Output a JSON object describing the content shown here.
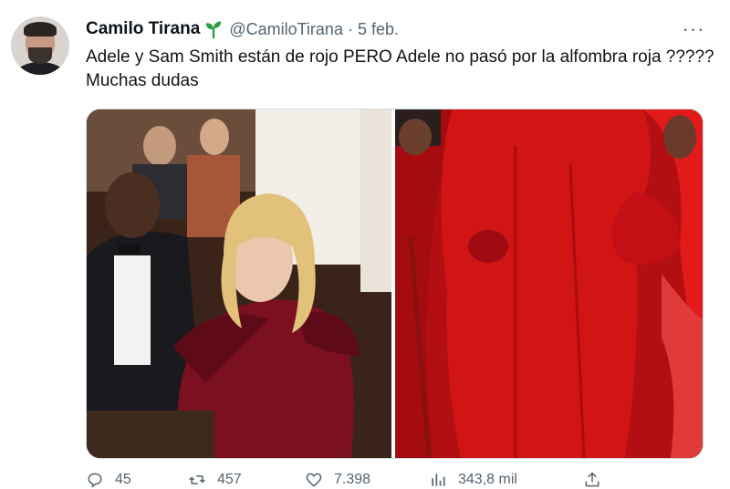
{
  "tweet": {
    "author_name": "Camilo Tirana",
    "author_handle": "@CamiloTirana",
    "separator": "·",
    "date": "5 feb.",
    "text": "Adele y Sam Smith están de rojo PERO Adele no pasó por la alfombra roja ????? Muchas dudas",
    "more_label": "···"
  },
  "actions": {
    "replies": "45",
    "retweets": "457",
    "likes": "7.398",
    "views": "343,8 mil"
  },
  "icons": [
    "sprout-icon",
    "more-icon",
    "reply-icon",
    "retweet-icon",
    "like-icon",
    "views-icon",
    "share-icon"
  ],
  "colors": {
    "text_primary": "#0f1419",
    "text_secondary": "#536471",
    "sprout_green": "#2f9e44",
    "left_photo_gown": "#7a1020",
    "right_photo_red": "#d11515"
  }
}
